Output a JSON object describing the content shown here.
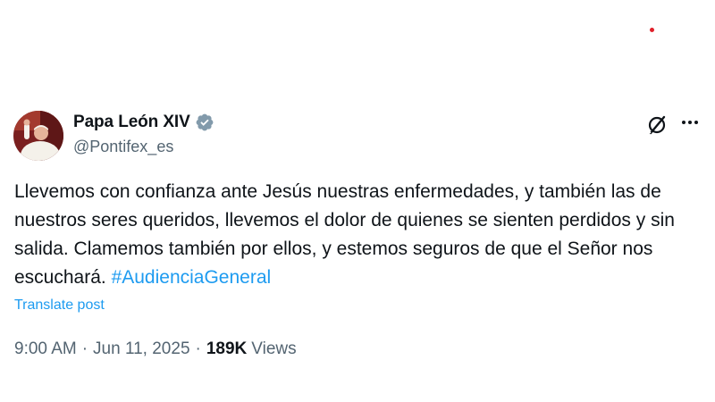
{
  "author": {
    "display_name": "Papa León XIV",
    "handle": "@Pontifex_es",
    "verified": true
  },
  "tweet": {
    "text_main": "Llevemos con confianza ante Jesús nuestras enfermedades, y también las de nuestros seres queridos, llevemos el dolor de quienes se sienten perdidos y sin salida. Clamemos también por ellos, y estemos seguros de que el Señor nos escuchará. ",
    "hashtag": "#AudienciaGeneral",
    "translate_label": "Translate post",
    "time": "9:00 AM",
    "date": "Jun 11, 2025",
    "separator": "·",
    "views_count": "189K",
    "views_label": "Views"
  },
  "icons": {
    "verified": "verified-badge-icon",
    "grok": "grok-icon",
    "more": "more-icon"
  },
  "colors": {
    "link": "#1d9bf0",
    "text_primary": "#0f1419",
    "text_secondary": "#536471",
    "verified_badge": "#829aab",
    "notification_dot": "#e0202a"
  }
}
